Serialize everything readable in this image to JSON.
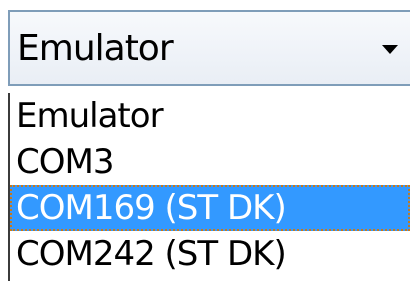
{
  "combo": {
    "value": "Emulator",
    "arrow_icon": "chevron-down-icon"
  },
  "dropdown": {
    "options": [
      {
        "label": "Emulator",
        "selected": false
      },
      {
        "label": "COM3",
        "selected": false
      },
      {
        "label": "COM169 (ST DK)",
        "selected": true
      },
      {
        "label": "COM242 (ST DK)",
        "selected": false
      }
    ]
  },
  "colors": {
    "selection_background": "#3399ff",
    "selection_text": "#ffffff",
    "focus_outline": "#c8791a",
    "combo_border": "#7f9db9"
  }
}
